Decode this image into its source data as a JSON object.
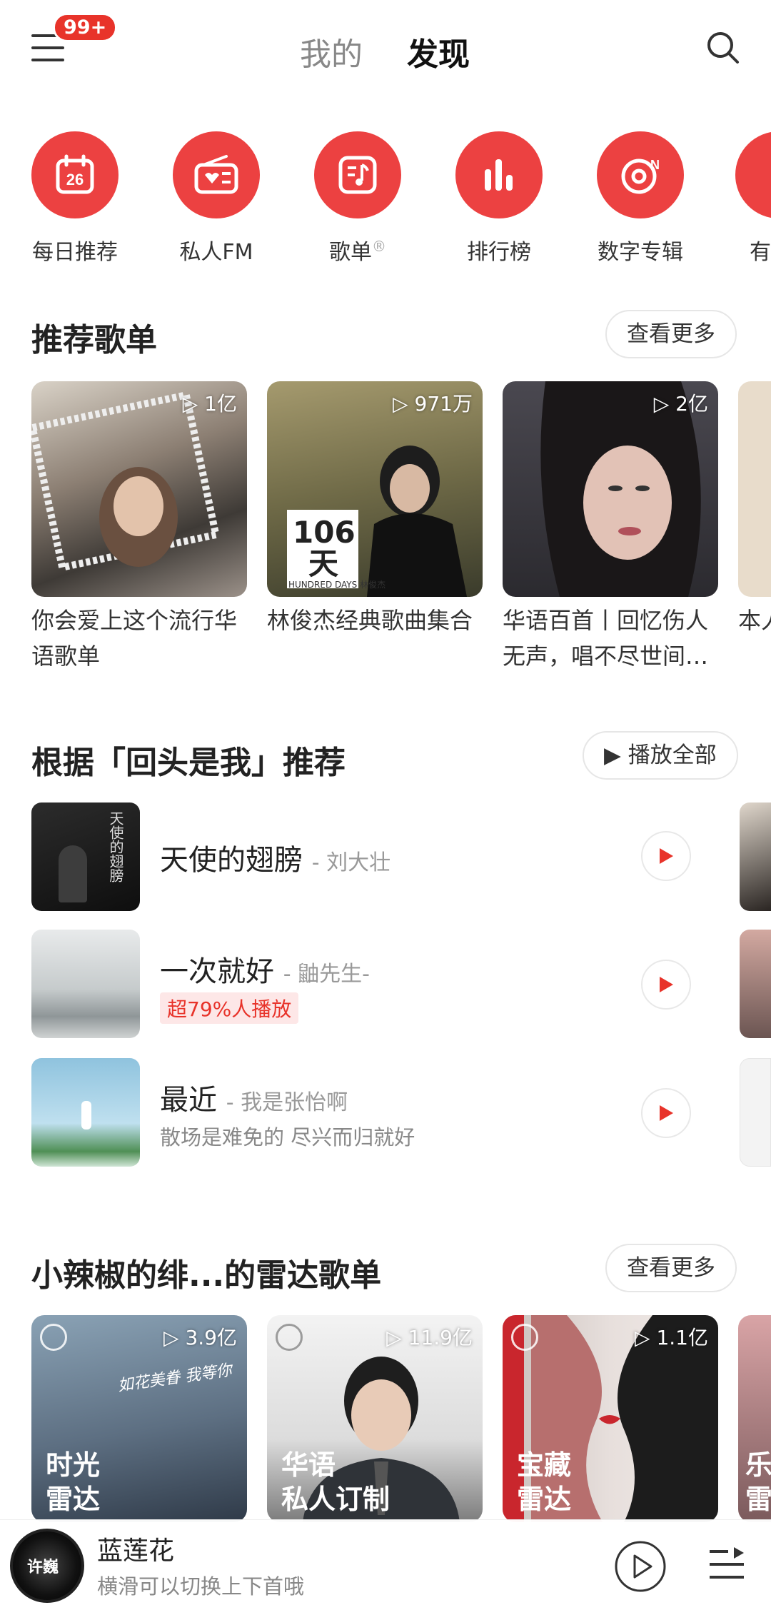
{
  "header": {
    "badge": "99+",
    "tabs": [
      "我的",
      "发现"
    ]
  },
  "categories": [
    {
      "label": "每日推荐",
      "icon": "calendar-icon",
      "date": "26"
    },
    {
      "label": "私人FM",
      "icon": "radio-icon"
    },
    {
      "label": "歌单",
      "icon": "playlist-note-icon",
      "mark": "®"
    },
    {
      "label": "排行榜",
      "icon": "bar-chart-icon"
    },
    {
      "label": "数字专辑",
      "icon": "digital-album-icon"
    },
    {
      "label": "有",
      "icon": "partial-icon"
    }
  ],
  "recommended": {
    "title": "推荐歌单",
    "more": "查看更多",
    "cards": [
      {
        "plays": "1亿",
        "title": "你会爱上这个流行华语歌单"
      },
      {
        "plays": "971万",
        "title": "林俊杰经典歌曲集合",
        "cover_text": "106天",
        "cover_sub": "HUNDRED DAYS 林俊杰"
      },
      {
        "plays": "2亿",
        "title": "华语百首丨回忆伤人无声，唱不尽世间…"
      },
      {
        "plays": "",
        "title": "本人"
      }
    ]
  },
  "based_on": {
    "title": "根据「回头是我」推荐",
    "play_all": "播放全部",
    "songs": [
      {
        "name": "天使的翅膀",
        "artist": "- 刘大壮",
        "cover_text": "天使的翅膀"
      },
      {
        "name": "一次就好",
        "artist": "- 鼬先生-",
        "tag": "超79%人播放"
      },
      {
        "name": "最近",
        "artist": "- 我是张怡啊",
        "sub": "散场是难免的 尽兴而归就好"
      }
    ]
  },
  "radar": {
    "title": "小辣椒的绯...的雷达歌单",
    "more": "查看更多",
    "cards": [
      {
        "plays": "3.9亿",
        "line1": "时光",
        "line2": "雷达",
        "deco": "如花美眷 我等你"
      },
      {
        "plays": "11.9亿",
        "line1": "华语",
        "line2": "私人订制"
      },
      {
        "plays": "1.1亿",
        "line1": "宝藏",
        "line2": "雷达"
      },
      {
        "plays": "",
        "line1": "乐",
        "line2": "雷"
      }
    ]
  },
  "player": {
    "title": "蓝莲花",
    "hint": "横滑可以切换上下首哦",
    "cover_text": "许巍"
  },
  "colors": {
    "accent": "#ec4141"
  }
}
